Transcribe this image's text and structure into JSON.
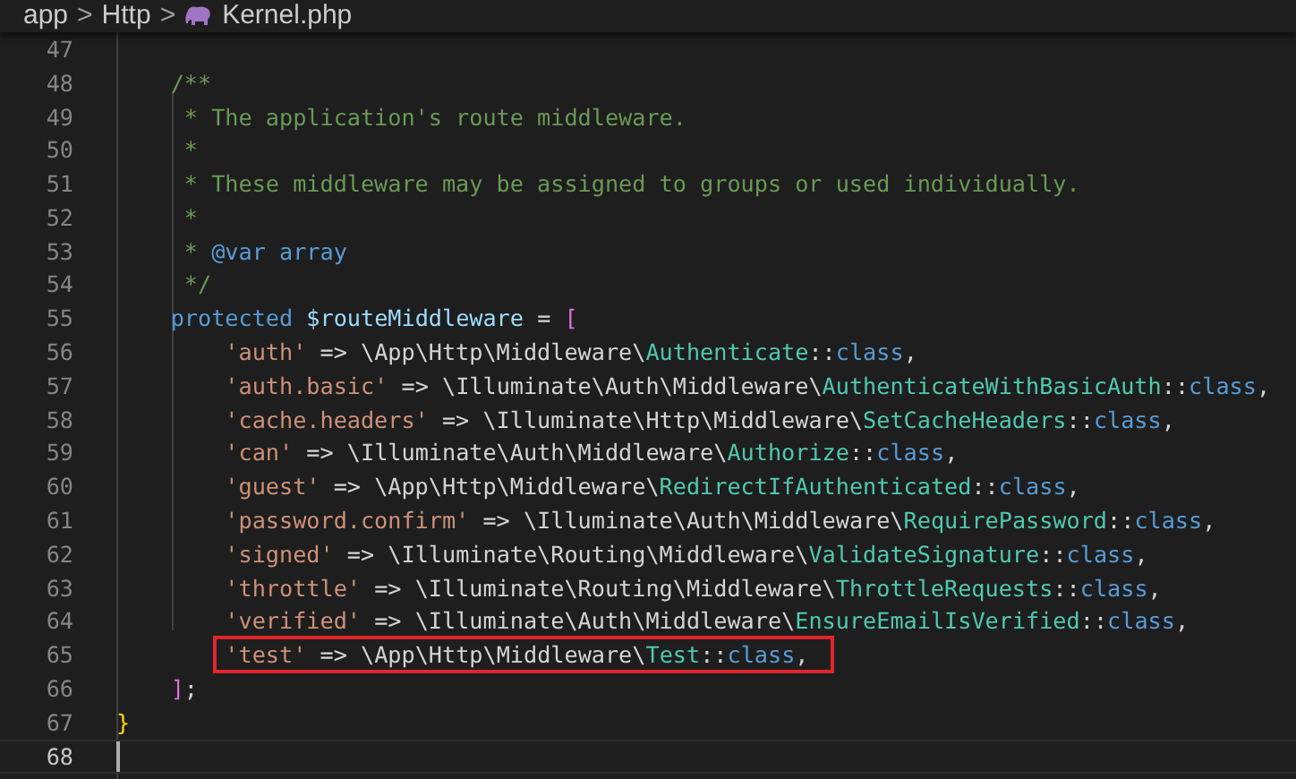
{
  "breadcrumb": [
    {
      "label": "app",
      "kind": "folder"
    },
    {
      "label": "Http",
      "kind": "folder"
    },
    {
      "label": "Kernel.php",
      "kind": "php-file"
    }
  ],
  "separator": ">",
  "lines": [
    {
      "number": "47",
      "current": false,
      "boxed": false
    },
    {
      "number": "48",
      "current": false,
      "boxed": false,
      "tokens": [
        {
          "text": "    /**",
          "kind": "comment"
        }
      ]
    },
    {
      "number": "49",
      "current": false,
      "boxed": false,
      "tokens": [
        {
          "text": "     * The application's route middleware.",
          "kind": "comment"
        }
      ]
    },
    {
      "number": "50",
      "current": false,
      "boxed": false,
      "tokens": [
        {
          "text": "     *",
          "kind": "comment"
        }
      ]
    },
    {
      "number": "51",
      "current": false,
      "boxed": false,
      "tokens": [
        {
          "text": "     * These middleware may be assigned to groups or used individually.",
          "kind": "comment"
        }
      ]
    },
    {
      "number": "52",
      "current": false,
      "boxed": false,
      "tokens": [
        {
          "text": "     *",
          "kind": "comment"
        }
      ]
    },
    {
      "number": "53",
      "current": false,
      "boxed": false,
      "tokens": [
        {
          "text": "     * ",
          "kind": "comment"
        },
        {
          "text": "@var array",
          "kind": "keyword"
        }
      ]
    },
    {
      "number": "54",
      "current": false,
      "boxed": false,
      "tokens": [
        {
          "text": "     */",
          "kind": "comment"
        }
      ]
    },
    {
      "number": "55",
      "current": false,
      "boxed": false,
      "tokens": [
        {
          "text": "    protected",
          "kind": "keyword"
        },
        {
          "text": " $routeMiddleware",
          "kind": "variable"
        },
        {
          "text": " = ",
          "kind": "plain"
        },
        {
          "text": "[",
          "kind": "bracket"
        }
      ]
    },
    {
      "number": "56",
      "current": false,
      "boxed": false,
      "tokens": [
        {
          "text": "        'auth'",
          "kind": "string"
        },
        {
          "text": " => \\App\\Http\\Middleware\\",
          "kind": "plain"
        },
        {
          "text": "Authenticate",
          "kind": "type"
        },
        {
          "text": "::",
          "kind": "plain"
        },
        {
          "text": "class",
          "kind": "keyword"
        },
        {
          "text": ",",
          "kind": "plain"
        }
      ]
    },
    {
      "number": "57",
      "current": false,
      "boxed": false,
      "tokens": [
        {
          "text": "        'auth.basic'",
          "kind": "string"
        },
        {
          "text": " => \\Illuminate\\Auth\\Middleware\\",
          "kind": "plain"
        },
        {
          "text": "AuthenticateWithBasicAuth",
          "kind": "type"
        },
        {
          "text": "::",
          "kind": "plain"
        },
        {
          "text": "class",
          "kind": "keyword"
        },
        {
          "text": ",",
          "kind": "plain"
        }
      ]
    },
    {
      "number": "58",
      "current": false,
      "boxed": false,
      "tokens": [
        {
          "text": "        'cache.headers'",
          "kind": "string"
        },
        {
          "text": " => \\Illuminate\\Http\\Middleware\\",
          "kind": "plain"
        },
        {
          "text": "SetCacheHeaders",
          "kind": "type"
        },
        {
          "text": "::",
          "kind": "plain"
        },
        {
          "text": "class",
          "kind": "keyword"
        },
        {
          "text": ",",
          "kind": "plain"
        }
      ]
    },
    {
      "number": "59",
      "current": false,
      "boxed": false,
      "tokens": [
        {
          "text": "        'can'",
          "kind": "string"
        },
        {
          "text": " => \\Illuminate\\Auth\\Middleware\\",
          "kind": "plain"
        },
        {
          "text": "Authorize",
          "kind": "type"
        },
        {
          "text": "::",
          "kind": "plain"
        },
        {
          "text": "class",
          "kind": "keyword"
        },
        {
          "text": ",",
          "kind": "plain"
        }
      ]
    },
    {
      "number": "60",
      "current": false,
      "boxed": false,
      "tokens": [
        {
          "text": "        'guest'",
          "kind": "string"
        },
        {
          "text": " => \\App\\Http\\Middleware\\",
          "kind": "plain"
        },
        {
          "text": "RedirectIfAuthenticated",
          "kind": "type"
        },
        {
          "text": "::",
          "kind": "plain"
        },
        {
          "text": "class",
          "kind": "keyword"
        },
        {
          "text": ",",
          "kind": "plain"
        }
      ]
    },
    {
      "number": "61",
      "current": false,
      "boxed": false,
      "tokens": [
        {
          "text": "        'password.confirm'",
          "kind": "string"
        },
        {
          "text": " => \\Illuminate\\Auth\\Middleware\\",
          "kind": "plain"
        },
        {
          "text": "RequirePassword",
          "kind": "type"
        },
        {
          "text": "::",
          "kind": "plain"
        },
        {
          "text": "class",
          "kind": "keyword"
        },
        {
          "text": ",",
          "kind": "plain"
        }
      ]
    },
    {
      "number": "62",
      "current": false,
      "boxed": false,
      "tokens": [
        {
          "text": "        'signed'",
          "kind": "string"
        },
        {
          "text": " => \\Illuminate\\Routing\\Middleware\\",
          "kind": "plain"
        },
        {
          "text": "ValidateSignature",
          "kind": "type"
        },
        {
          "text": "::",
          "kind": "plain"
        },
        {
          "text": "class",
          "kind": "keyword"
        },
        {
          "text": ",",
          "kind": "plain"
        }
      ]
    },
    {
      "number": "63",
      "current": false,
      "boxed": false,
      "tokens": [
        {
          "text": "        'throttle'",
          "kind": "string"
        },
        {
          "text": " => \\Illuminate\\Routing\\Middleware\\",
          "kind": "plain"
        },
        {
          "text": "ThrottleRequests",
          "kind": "type"
        },
        {
          "text": "::",
          "kind": "plain"
        },
        {
          "text": "class",
          "kind": "keyword"
        },
        {
          "text": ",",
          "kind": "plain"
        }
      ]
    },
    {
      "number": "64",
      "current": false,
      "boxed": false,
      "tokens": [
        {
          "text": "        'verified'",
          "kind": "string"
        },
        {
          "text": " => \\Illuminate\\Auth\\Middleware\\",
          "kind": "plain"
        },
        {
          "text": "EnsureEmailIsVerified",
          "kind": "type"
        },
        {
          "text": "::",
          "kind": "plain"
        },
        {
          "text": "class",
          "kind": "keyword"
        },
        {
          "text": ",",
          "kind": "plain"
        }
      ]
    },
    {
      "number": "65",
      "current": false,
      "boxed": true,
      "tokens": [
        {
          "text": "        'test'",
          "kind": "string"
        },
        {
          "text": " => \\App\\Http\\Middleware\\",
          "kind": "plain"
        },
        {
          "text": "Test",
          "kind": "type"
        },
        {
          "text": "::",
          "kind": "plain"
        },
        {
          "text": "class",
          "kind": "keyword"
        },
        {
          "text": ",",
          "kind": "plain"
        }
      ]
    },
    {
      "number": "66",
      "current": false,
      "boxed": false,
      "tokens": [
        {
          "text": "    ]",
          "kind": "bracket"
        },
        {
          "text": ";",
          "kind": "plain"
        }
      ]
    },
    {
      "number": "67",
      "current": false,
      "boxed": false,
      "tokens": [
        {
          "text": "}",
          "kind": "brace"
        }
      ]
    },
    {
      "number": "68",
      "current": true,
      "boxed": false
    }
  ]
}
